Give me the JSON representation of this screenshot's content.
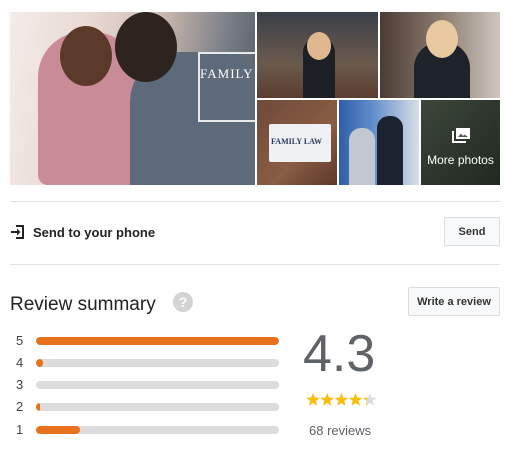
{
  "gallery": {
    "main_sign_text": "FAMILY",
    "plaque_text": "FAMILY LAW",
    "more_photos_label": "More photos",
    "more_photos_icon": "photo-library-icon"
  },
  "send": {
    "icon": "send-to-device-icon",
    "label": "Send to your phone",
    "button_label": "Send"
  },
  "review_summary": {
    "title": "Review summary",
    "help_icon_glyph": "?",
    "write_button_label": "Write a review",
    "rating": "4.3",
    "rating_value": 4.3,
    "reviews_label": "68 reviews",
    "star_color": "#fbbc04",
    "bar_color": "#e8711c",
    "distribution": [
      {
        "label": "5",
        "fraction": 1.0
      },
      {
        "label": "4",
        "fraction": 0.03
      },
      {
        "label": "3",
        "fraction": 0.0
      },
      {
        "label": "2",
        "fraction": 0.015
      },
      {
        "label": "1",
        "fraction": 0.18
      }
    ]
  }
}
